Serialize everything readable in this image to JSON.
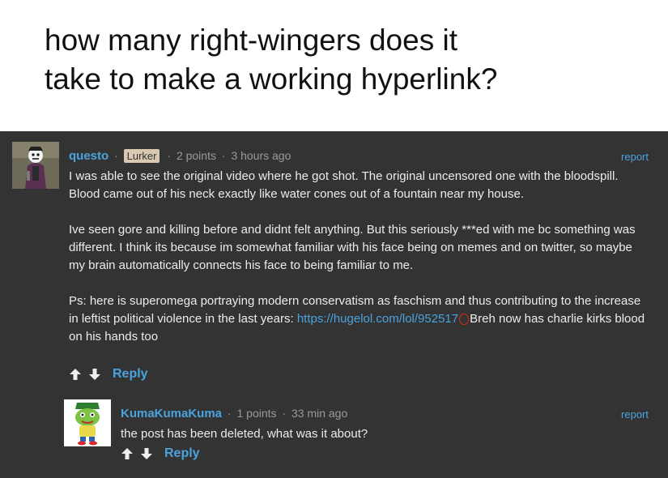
{
  "caption": {
    "line1": "how many right-wingers does it",
    "line2": "take to make a working hyperlink?"
  },
  "comments": [
    {
      "username": "questo",
      "badge": "Lurker",
      "points": "2 points",
      "time": "3 hours ago",
      "report": "report",
      "paragraphs": [
        "I was able to see the original video where he got shot. The original uncensored one with the bloodspill. Blood came out of his neck exactly like water cones out of a fountain near my house.",
        "Ive seen gore and killing before and didnt felt anything. But this seriously ***ed with me bc something was different. I think its because im somewhat familiar with his face being on memes and on twitter, so maybe my brain automatically connects his face to being familiar to me."
      ],
      "last_paragraph_before_link": "Ps: here is superomega portraying modern conservatism as faschism and thus contributing to the increase in leftist political violence in the last years: ",
      "link": "https://hugelol.com/lol/952517",
      "last_paragraph_after_link": "Breh now has charlie kirks blood on his hands too",
      "reply": "Reply"
    },
    {
      "username": "KumaKumaKuma",
      "points": "1 points",
      "time": "33 min ago",
      "report": "report",
      "text": "the post has been deleted, what was it about?",
      "reply": "Reply"
    }
  ],
  "colors": {
    "background": "#333333",
    "accent": "#4aa3df",
    "annotation": "#e0241b"
  }
}
